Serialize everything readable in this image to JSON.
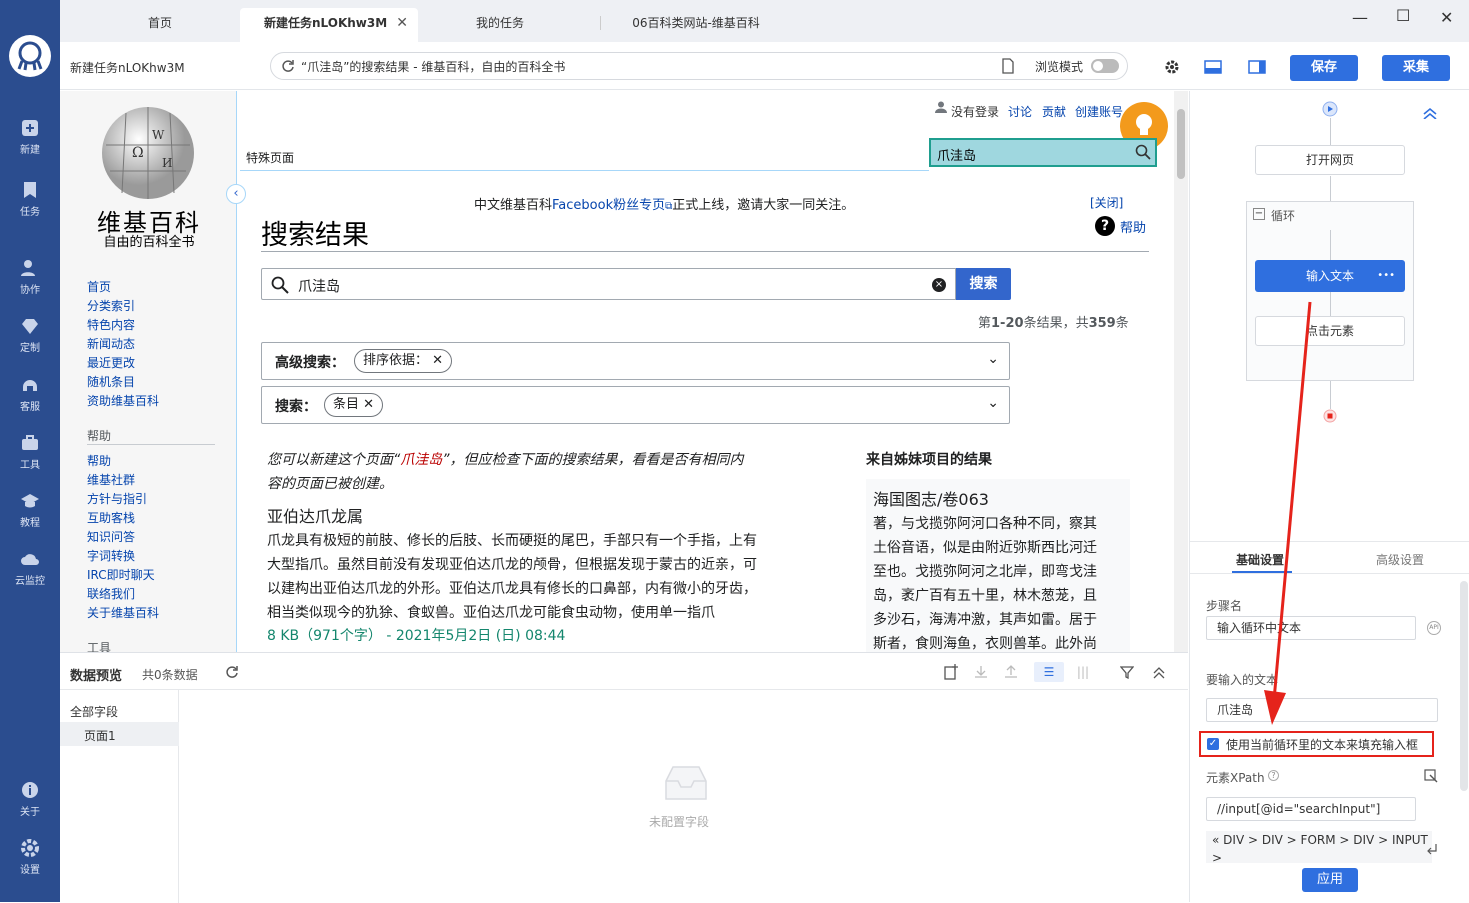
{
  "app": {
    "rail": [
      "新建",
      "任务",
      "协作",
      "定制",
      "客服",
      "工具",
      "教程",
      "云监控",
      "关于",
      "设置"
    ],
    "tabs": [
      {
        "label": "首页"
      },
      {
        "label": "新建任务nLOKhw3M",
        "close": "✕"
      },
      {
        "label": "我的任务"
      },
      {
        "label": "06百科类网站-维基百科"
      }
    ],
    "window": {
      "min": "—",
      "max": "☐",
      "close": "✕"
    }
  },
  "addressbar": {
    "task_name": "新建任务nLOKhw3M",
    "url": "“爪洼岛”的搜索结果 - 维基百科，自由的百科全书",
    "browse_mode": "浏览模式",
    "save": "保存",
    "collect": "采集"
  },
  "wiki": {
    "logo_title": "维基百科",
    "logo_sub": "自由的百科全书",
    "nav": [
      "首页",
      "分类索引",
      "特色内容",
      "新闻动态",
      "最近更改",
      "随机条目",
      "资助维基百科"
    ],
    "help_heading": "帮助",
    "help_links": [
      "帮助",
      "维基社群",
      "方针与指引",
      "互助客栈",
      "知识问答",
      "字词转换",
      "IRC即时聊天",
      "联络我们",
      "关于维基百科"
    ],
    "tools_heading": "工具",
    "user_links": [
      "没有登录",
      "讨论",
      "贡献",
      "创建账号"
    ],
    "special_tab": "特殊页面",
    "search_value": "爪洼岛",
    "banner_prefix": "中文维基百科",
    "banner_link": "Facebook粉丝专页",
    "banner_suffix": "正式上线，邀请大家一同关注。",
    "banner_close": "[关闭]",
    "help_label": "帮助",
    "page_heading": "搜索结果",
    "query": "爪洼岛",
    "search_btn": "搜索",
    "result_count_prefix": "第",
    "result_range": "1-20",
    "result_count_mid": "条结果，共",
    "result_total": "359",
    "result_count_suffix": "条",
    "advanced_label": "高级搜索：",
    "advanced_chip": "排序依据：",
    "search_label": "搜索：",
    "search_chip": "条目",
    "create_note_1": "您可以新建这个页面“",
    "create_note_term": "爪洼岛",
    "create_note_2": "”，但应检查下面的搜索结果，看看是否有相同内",
    "create_note_3": "容的页面已被创建。",
    "result_title": "亚伯达爪龙属",
    "result_lines": [
      "爪龙具有极短的前肢、修长的后肢、长而硬挺的尾巴，手部只有一个手指，上有",
      "大型指爪。虽然目前没有发现亚伯达爪龙的颅骨，但根据发现于蒙古的近亲，可",
      "以建构出亚伯达爪龙的外形。亚伯达爪龙具有修长的口鼻部，内有微小的牙齿，",
      "相当类似现今的犰狳、食蚁兽。亚伯达爪龙可能食虫动物，使用单一指爪"
    ],
    "result_meta": "8 KB（971个字） - 2021年5月2日 (日) 08:44",
    "sister_heading": "来自姊妹项目的结果",
    "sister_title": "海国图志/卷063",
    "sister_lines": [
      "著，与戈揽弥阿河口各种不同，察其",
      "土俗音语，似是由附近弥斯西比河迁",
      "至也。戈揽弥阿河之北岸，即弯戈洼",
      "岛，袤广百有五十里，林木葱茏，且",
      "多沙石，海涛冲激，其声如雷。居于",
      "斯者，食则海鱼，衣则兽革。此外尚"
    ]
  },
  "data_preview": {
    "title": "数据预览",
    "count": "共0条数据",
    "all_fields": "全部字段",
    "page1": "页面1",
    "empty": "未配置字段"
  },
  "workflow": {
    "open_page": "打开网页",
    "loop": "循环",
    "input_text": "输入文本",
    "more": "•••",
    "click_element": "点击元素"
  },
  "settings": {
    "tab_basic": "基础设置",
    "tab_advanced": "高级设置",
    "step_name_label": "步骤名",
    "step_name": "输入循环中文本",
    "text_label": "要输入的文本",
    "text_value": "爪洼岛",
    "checkbox_label": "使用当前循环里的文本来填充输入框",
    "checkbox_checked": true,
    "xpath_label": "元素XPath",
    "xpath_value": "//input[@id=\"searchInput\"]",
    "breadcrumb": [
      "DIV",
      "DIV",
      "FORM",
      "DIV",
      "INPUT"
    ],
    "apply": "应用"
  },
  "colors": {
    "rail": "#2b4d8f",
    "accent": "#2f6fdf",
    "annotation": "#e5231b"
  }
}
